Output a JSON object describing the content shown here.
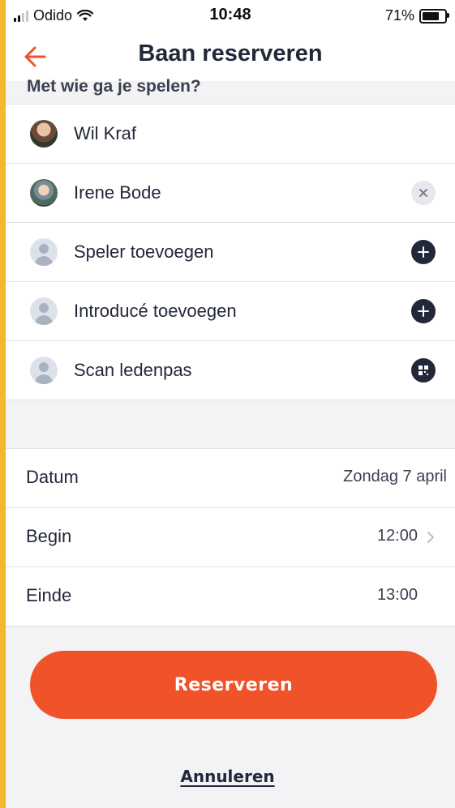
{
  "status_bar": {
    "carrier": "Odido",
    "time": "10:48",
    "battery": "71%"
  },
  "header": {
    "title": "Baan reserveren",
    "back_icon": "arrow-left-icon"
  },
  "players_section": {
    "title": "Met wie ga je spelen?",
    "rows": [
      {
        "name": "Wil Kraf",
        "avatar": "photo",
        "action": null
      },
      {
        "name": "Irene Bode",
        "avatar": "photo",
        "action": "remove-icon"
      },
      {
        "name": "Speler toevoegen",
        "avatar": "generic",
        "action": "plus-icon"
      },
      {
        "name": "Introducé toevoegen",
        "avatar": "generic",
        "action": "plus-icon"
      },
      {
        "name": "Scan ledenpas",
        "avatar": "generic",
        "action": "qr-icon"
      }
    ]
  },
  "details": {
    "date_label": "Datum",
    "date_value": "Zondag 7 april",
    "begin_label": "Begin",
    "begin_value": "12:00",
    "end_label": "Einde",
    "end_value": "13:00"
  },
  "actions": {
    "reserve_label": "Reserveren",
    "cancel_label": "Annuleren"
  },
  "colors": {
    "accent": "#f0522a",
    "dark": "#22283a",
    "frame": "#f4b82a"
  }
}
